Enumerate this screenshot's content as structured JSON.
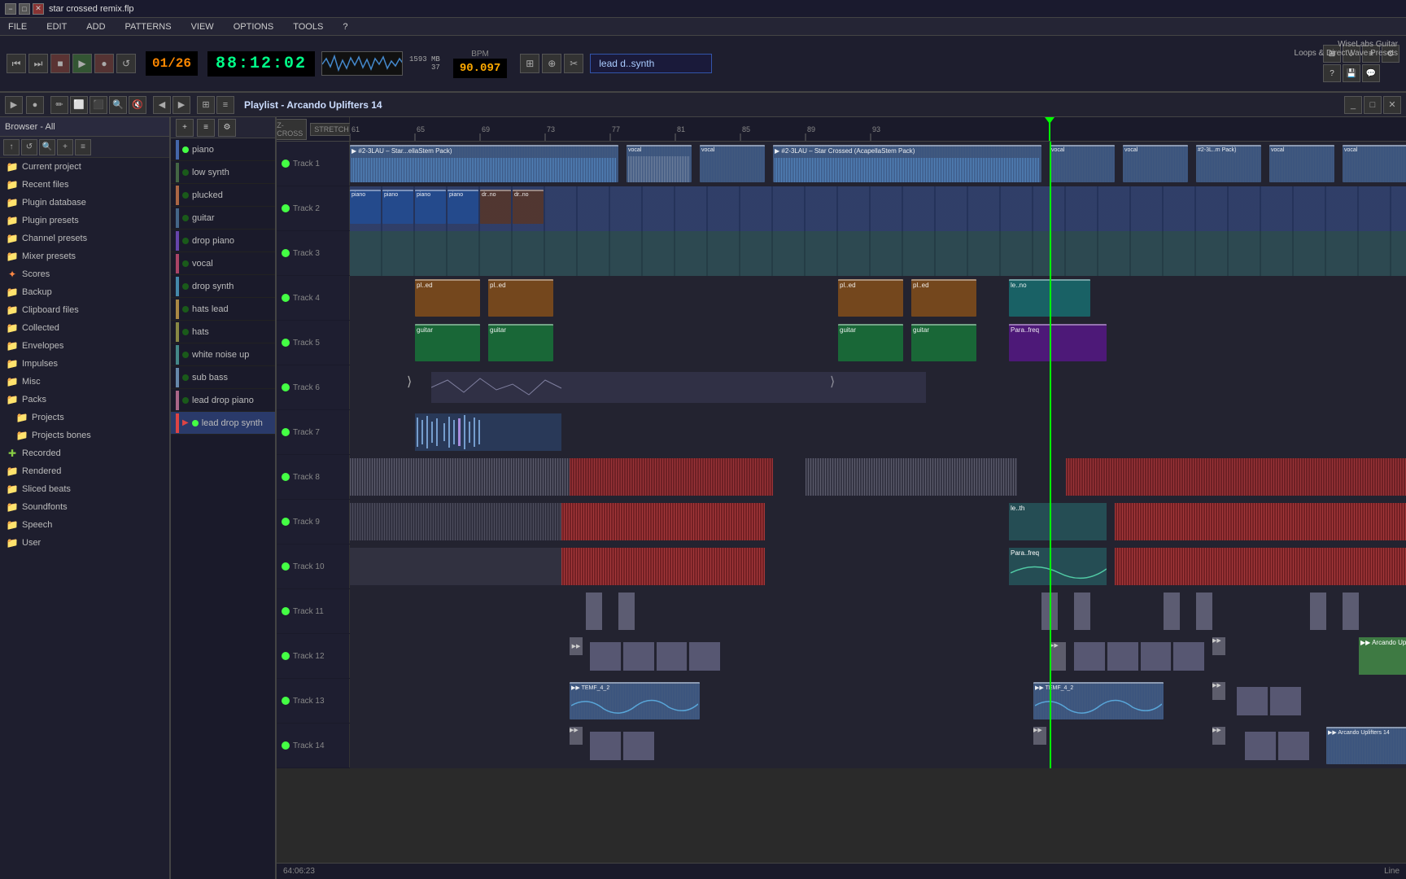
{
  "titlebar": {
    "title": "star crossed remix.flp",
    "buttons": [
      "−",
      "□",
      "✕"
    ]
  },
  "menubar": {
    "items": [
      "FILE",
      "EDIT",
      "ADD",
      "PATTERNS",
      "VIEW",
      "OPTIONS",
      "TOOLS",
      "?"
    ]
  },
  "transport": {
    "time": "88:12:02",
    "bpm": "90.097",
    "pattern_num": "01/26",
    "preset": "lead d..synth",
    "preset_info": "WiseLabs Guitar",
    "preset_sub": "Loops & DirectWave Presets",
    "memory": "1593 MB",
    "memory2": "37",
    "counter": "64:06:23"
  },
  "playlist": {
    "title": "Playlist - Arcando Uplifters 14",
    "tracks": [
      {
        "name": "Track 1",
        "num": 1
      },
      {
        "name": "Track 2",
        "num": 2
      },
      {
        "name": "Track 3",
        "num": 3
      },
      {
        "name": "Track 4",
        "num": 4
      },
      {
        "name": "Track 5",
        "num": 5
      },
      {
        "name": "Track 6",
        "num": 6
      },
      {
        "name": "Track 7",
        "num": 7
      },
      {
        "name": "Track 8",
        "num": 8
      },
      {
        "name": "Track 9",
        "num": 9
      },
      {
        "name": "Track 10",
        "num": 10
      },
      {
        "name": "Track 11",
        "num": 11
      },
      {
        "name": "Track 12",
        "num": 12
      },
      {
        "name": "Track 13",
        "num": 13
      },
      {
        "name": "Track 14",
        "num": 14
      }
    ]
  },
  "instruments": [
    {
      "name": "piano",
      "color": "#4466aa",
      "active": true
    },
    {
      "name": "low synth",
      "color": "#446644",
      "active": false
    },
    {
      "name": "plucked",
      "color": "#aa6644",
      "active": false
    },
    {
      "name": "guitar",
      "color": "#446688",
      "active": false
    },
    {
      "name": "drop piano",
      "color": "#6644aa",
      "active": false
    },
    {
      "name": "vocal",
      "color": "#aa4466",
      "active": false
    },
    {
      "name": "drop synth",
      "color": "#4488aa",
      "active": false
    },
    {
      "name": "hats lead",
      "color": "#aa8844",
      "active": false
    },
    {
      "name": "hats",
      "color": "#888844",
      "active": false
    },
    {
      "name": "white noise up",
      "color": "#448888",
      "active": false
    },
    {
      "name": "sub bass",
      "color": "#6688aa",
      "active": false
    },
    {
      "name": "lead drop piano",
      "color": "#aa6688",
      "active": false
    },
    {
      "name": "lead drop synth",
      "color": "#dd4444",
      "active": true
    }
  ],
  "sidebar": {
    "header": "Browser - All",
    "items": [
      {
        "label": "Current project",
        "icon": "folder",
        "indent": 0
      },
      {
        "label": "Recent files",
        "icon": "folder",
        "indent": 0
      },
      {
        "label": "Plugin database",
        "icon": "folder",
        "indent": 0
      },
      {
        "label": "Plugin presets",
        "icon": "folder",
        "indent": 0
      },
      {
        "label": "Channel presets",
        "icon": "folder",
        "indent": 0
      },
      {
        "label": "Mixer presets",
        "icon": "folder",
        "indent": 0
      },
      {
        "label": "Scores",
        "icon": "star",
        "indent": 0
      },
      {
        "label": "Backup",
        "icon": "folder",
        "indent": 0
      },
      {
        "label": "Clipboard files",
        "icon": "folder",
        "indent": 0
      },
      {
        "label": "Collected",
        "icon": "folder",
        "indent": 0
      },
      {
        "label": "Envelopes",
        "icon": "folder",
        "indent": 0
      },
      {
        "label": "Impulses",
        "icon": "folder",
        "indent": 0
      },
      {
        "label": "Misc",
        "icon": "folder",
        "indent": 0
      },
      {
        "label": "Packs",
        "icon": "folder",
        "indent": 0
      },
      {
        "label": "Projects",
        "icon": "folder",
        "indent": 2
      },
      {
        "label": "Projects bones",
        "icon": "folder",
        "indent": 2
      },
      {
        "label": "Recorded",
        "icon": "plus",
        "indent": 0
      },
      {
        "label": "Rendered",
        "icon": "folder",
        "indent": 0
      },
      {
        "label": "Sliced beats",
        "icon": "folder",
        "indent": 0
      },
      {
        "label": "Soundfonts",
        "icon": "folder",
        "indent": 0
      },
      {
        "label": "Speech",
        "icon": "folder",
        "indent": 0
      },
      {
        "label": "User",
        "icon": "folder",
        "indent": 0
      }
    ]
  },
  "ruler": {
    "markers": [
      "61",
      "65",
      "69",
      "73",
      "77",
      "81",
      "85",
      "89",
      "93"
    ],
    "stretch": "STRETCH",
    "cross": "Z-CROSS"
  },
  "timeline_mode": "Line"
}
